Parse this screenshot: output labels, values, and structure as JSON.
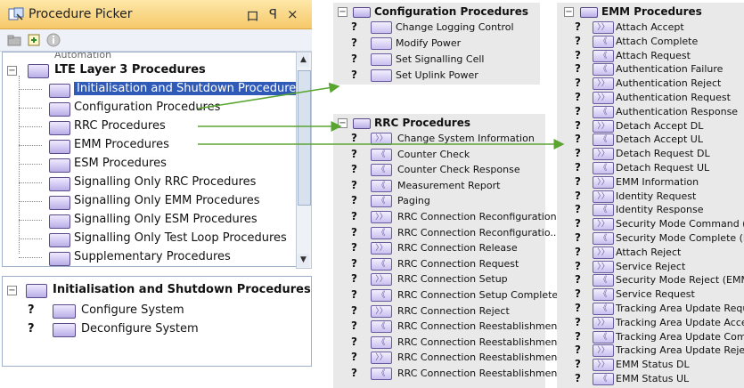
{
  "picker": {
    "title": "Procedure Picker",
    "pin_glyph": "ロ",
    "pin2_glyph": "ꟼ",
    "close_glyph": "×",
    "tree": {
      "partial_label": "Automation",
      "root": "LTE Layer 3 Procedures",
      "children": [
        "Initialisation and Shutdown Procedures",
        "Configuration Procedures",
        "RRC Procedures",
        "EMM Procedures",
        "ESM Procedures",
        "Signalling Only RRC Procedures",
        "Signalling Only EMM Procedures",
        "Signalling Only ESM Procedures",
        "Signalling Only Test Loop Procedures",
        "Supplementary Procedures"
      ],
      "selected_index": 0
    },
    "details": {
      "header": "Initialisation and Shutdown Procedures",
      "items": [
        "Configure System",
        "Deconfigure System"
      ]
    }
  },
  "config_panel": {
    "title": "Configuration Procedures",
    "items": [
      "Change Logging Control",
      "Modify Power",
      "Set Signalling Cell",
      "Set Uplink Power"
    ]
  },
  "rrc_panel": {
    "title": "RRC Procedures",
    "items": [
      "Change System Information",
      "Counter Check",
      "Counter Check Response",
      "Measurement Report",
      "Paging",
      "RRC Connection Reconfiguration",
      "RRC Connection Reconfiguratio...",
      "RRC Connection Release",
      "RRC Connection Request",
      "RRC Connection Setup",
      "RRC Connection Setup Complete",
      "RRC Connection Reject",
      "RRC Connection Reestablishment",
      "RRC Connection Reestablishmen...",
      "RRC Connection Reestablishmen...",
      "RRC Connection Reestablishmen..."
    ],
    "directions": [
      "out",
      "in",
      "in",
      "in",
      "in",
      "out",
      "in",
      "out",
      "in",
      "out",
      "in",
      "out",
      "in",
      "in",
      "out",
      "in"
    ]
  },
  "emm_panel": {
    "title": "EMM Procedures",
    "items": [
      "Attach Accept",
      "Attach Complete",
      "Attach Request",
      "Authentication Failure",
      "Authentication Reject",
      "Authentication Request",
      "Authentication Response",
      "Detach Accept DL",
      "Detach Accept UL",
      "Detach Request DL",
      "Detach Request UL",
      "EMM Information",
      "Identity Request",
      "Identity Response",
      "Security Mode Command (EMM)",
      "Security Mode Complete (EMM)",
      "Attach Reject",
      "Service Reject",
      "Security Mode Reject (EMM)",
      "Service Request",
      "Tracking Area Update Request",
      "Tracking Area Update Accept",
      "Tracking Area Update Complete",
      "Tracking Area Update Reject",
      "EMM Status DL",
      "EMM Status UL"
    ],
    "directions": [
      "out",
      "in",
      "in",
      "in",
      "out",
      "out",
      "in",
      "out",
      "in",
      "out",
      "in",
      "out",
      "out",
      "in",
      "out",
      "in",
      "out",
      "out",
      "in",
      "in",
      "in",
      "out",
      "in",
      "out",
      "out",
      "in"
    ]
  },
  "question_mark": "?",
  "colors": {
    "arrow": "#5aa532",
    "selection": "#2f5ab7",
    "panel_bg": "#e9e9e9",
    "titlebar": "#f6c96a"
  }
}
